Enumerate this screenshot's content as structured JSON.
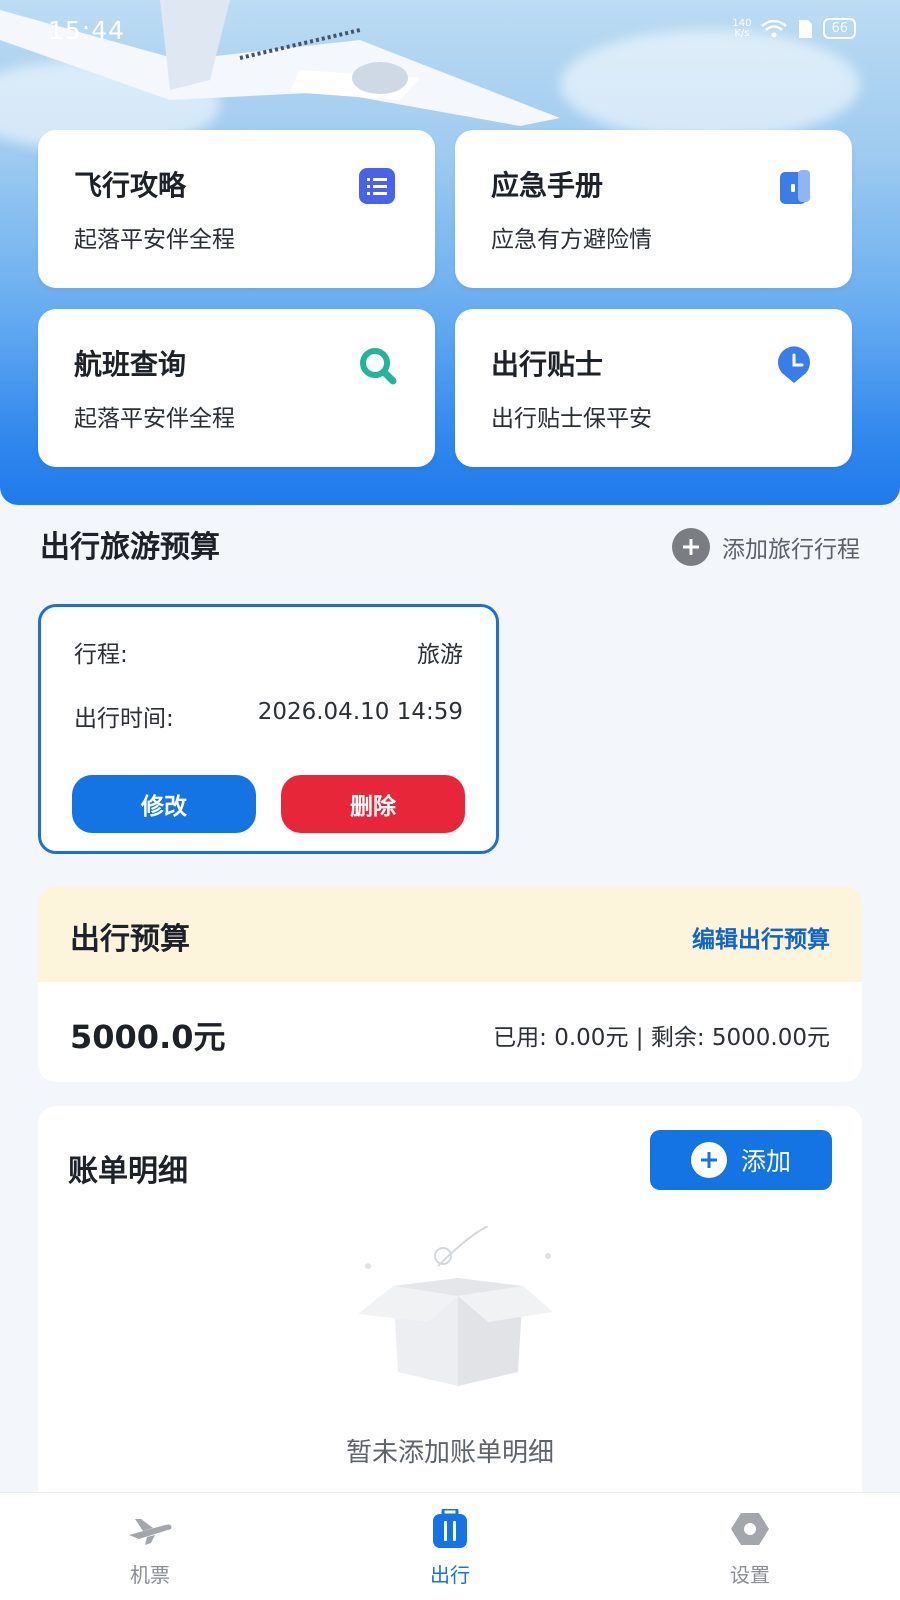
{
  "status_bar": {
    "time": "15:44",
    "net_speed_value": "140",
    "net_speed_unit": "K/s",
    "battery": "66"
  },
  "feature_cards": [
    {
      "title": "飞行攻略",
      "subtitle": "起落平安伴全程",
      "icon": "list-icon",
      "icon_color": "#4a62e8"
    },
    {
      "title": "应急手册",
      "subtitle": "应急有方避险情",
      "icon": "book-icon",
      "icon_color": "#3b7de8"
    },
    {
      "title": "航班查询",
      "subtitle": "起落平安伴全程",
      "icon": "search-icon",
      "icon_color": "#22b59a"
    },
    {
      "title": "出行贴士",
      "subtitle": "出行贴士保平安",
      "icon": "clock-icon",
      "icon_color": "#3b7de8"
    }
  ],
  "trip_section": {
    "title": "出行旅游预算",
    "add_label": "添加旅行行程"
  },
  "trip_card": {
    "itinerary_label": "行程:",
    "itinerary_value": "旅游",
    "time_label": "出行时间:",
    "time_value": "2026.04.10 14:59",
    "edit_label": "修改",
    "delete_label": "删除"
  },
  "budget": {
    "title": "出行预算",
    "edit_label": "编辑出行预算",
    "amount": "5000.0元",
    "usage": "已用: 0.00元 | 剩余: 5000.00元"
  },
  "bill": {
    "title": "账单明细",
    "add_label": "添加",
    "empty_text": "暂未添加账单明细"
  },
  "tabbar": [
    {
      "label": "机票",
      "icon": "airplane-icon",
      "active": false
    },
    {
      "label": "出行",
      "icon": "luggage-icon",
      "active": true
    },
    {
      "label": "设置",
      "icon": "settings-icon",
      "active": false
    }
  ],
  "colors": {
    "primary": "#1574e3",
    "danger": "#e8263a",
    "budget_header": "#fdf4dc"
  }
}
